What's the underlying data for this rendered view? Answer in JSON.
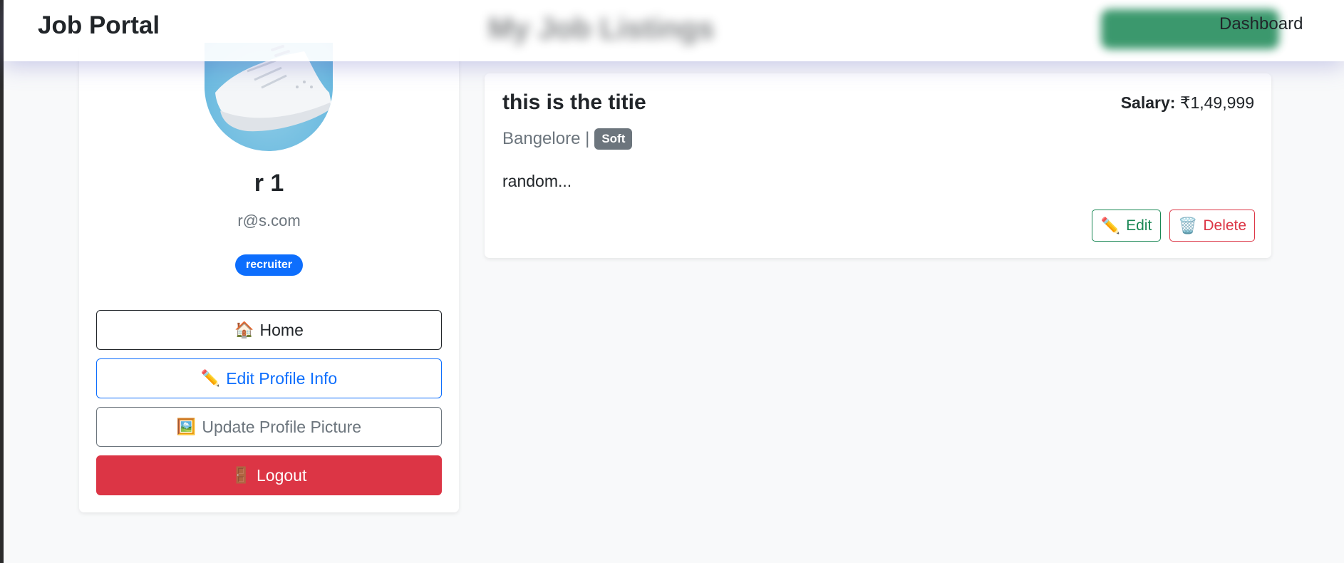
{
  "navbar": {
    "brand": "Job Portal",
    "page_heading": "My Job Listings",
    "dashboard_label": "Dashboard"
  },
  "profile": {
    "name": "r 1",
    "email": "r@s.com",
    "role": "recruiter",
    "buttons": {
      "home": {
        "icon": "house-icon",
        "label": "Home"
      },
      "edit_profile": {
        "icon": "pencil-icon",
        "label": "Edit Profile Info"
      },
      "update_picture": {
        "icon": "picture-icon",
        "label": "Update Profile Picture"
      },
      "logout": {
        "icon": "door-icon",
        "label": "Logout"
      }
    }
  },
  "jobs": [
    {
      "title": "this is the titie",
      "salary_label": "Salary:",
      "salary_value": "₹1,49,999",
      "location": "Bangelore |",
      "type": "Soft",
      "description": "random...",
      "edit_label": "Edit",
      "delete_label": "Delete"
    }
  ],
  "colors": {
    "primary": "#0d6efd",
    "success": "#198754",
    "danger": "#dc3545",
    "secondary": "#6c757d"
  }
}
